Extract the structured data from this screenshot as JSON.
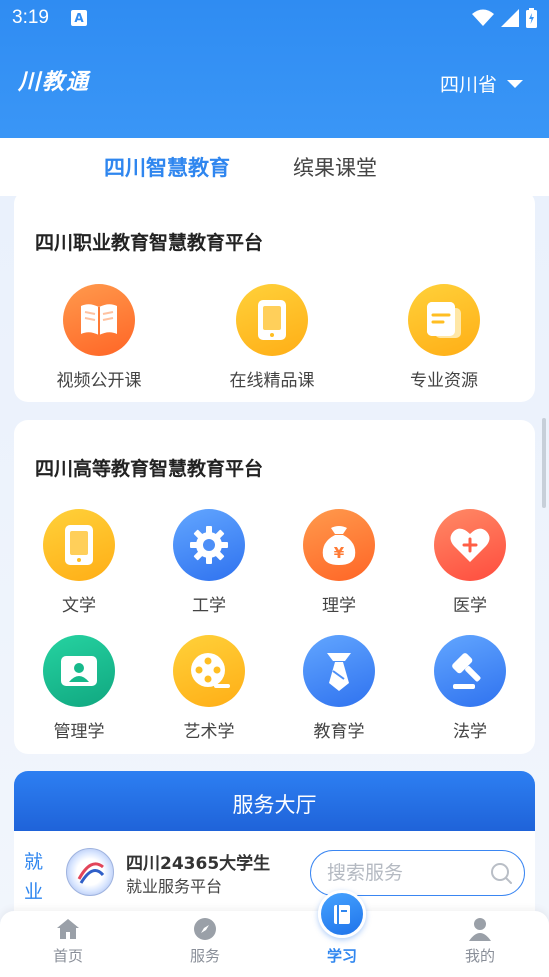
{
  "status_bar": {
    "time": "3:19",
    "notification_label": "A"
  },
  "header": {
    "app_logo": "川教通",
    "province": "四川省"
  },
  "tabs": [
    {
      "label": "四川智慧教育",
      "active": true
    },
    {
      "label": "缤果课堂",
      "active": false
    }
  ],
  "vocational": {
    "title": "四川职业教育智慧教育平台",
    "items": [
      {
        "label": "视频公开课",
        "icon": "book-icon",
        "color": "#ff7a35"
      },
      {
        "label": "在线精品课",
        "icon": "tablet-icon",
        "color": "#ffbe22"
      },
      {
        "label": "专业资源",
        "icon": "document-icon",
        "color": "#ffbe22"
      }
    ]
  },
  "higher": {
    "title": "四川高等教育智慧教育平台",
    "items": [
      {
        "label": "文学",
        "icon": "tablet-icon",
        "color": "#ffbe22"
      },
      {
        "label": "工学",
        "icon": "gear-icon",
        "color": "#3f86f5"
      },
      {
        "label": "理学",
        "icon": "money-bag-icon",
        "color": "#ff7a35"
      },
      {
        "label": "医学",
        "icon": "heart-plus-icon",
        "color": "#ff5e45"
      },
      {
        "label": "管理学",
        "icon": "user-card-icon",
        "color": "#16b98b"
      },
      {
        "label": "艺术学",
        "icon": "film-reel-icon",
        "color": "#ffbe22"
      },
      {
        "label": "教育学",
        "icon": "tie-icon",
        "color": "#3f86f5"
      },
      {
        "label": "法学",
        "icon": "gavel-icon",
        "color": "#3f86f5"
      }
    ]
  },
  "services": {
    "title": "服务大厅",
    "tag": "就业",
    "platform_title": "四川24365大学生",
    "platform_subtitle": "就业服务平台",
    "search_placeholder": "搜索服务"
  },
  "bottom_nav": [
    {
      "label": "首页",
      "icon": "home-icon",
      "active": false
    },
    {
      "label": "服务",
      "icon": "compass-icon",
      "active": false
    },
    {
      "label": "学习",
      "icon": "book-icon",
      "active": true
    },
    {
      "label": "我的",
      "icon": "person-icon",
      "active": false
    }
  ],
  "colors": {
    "primary": "#2f86ef",
    "header": "#3a96f6"
  }
}
